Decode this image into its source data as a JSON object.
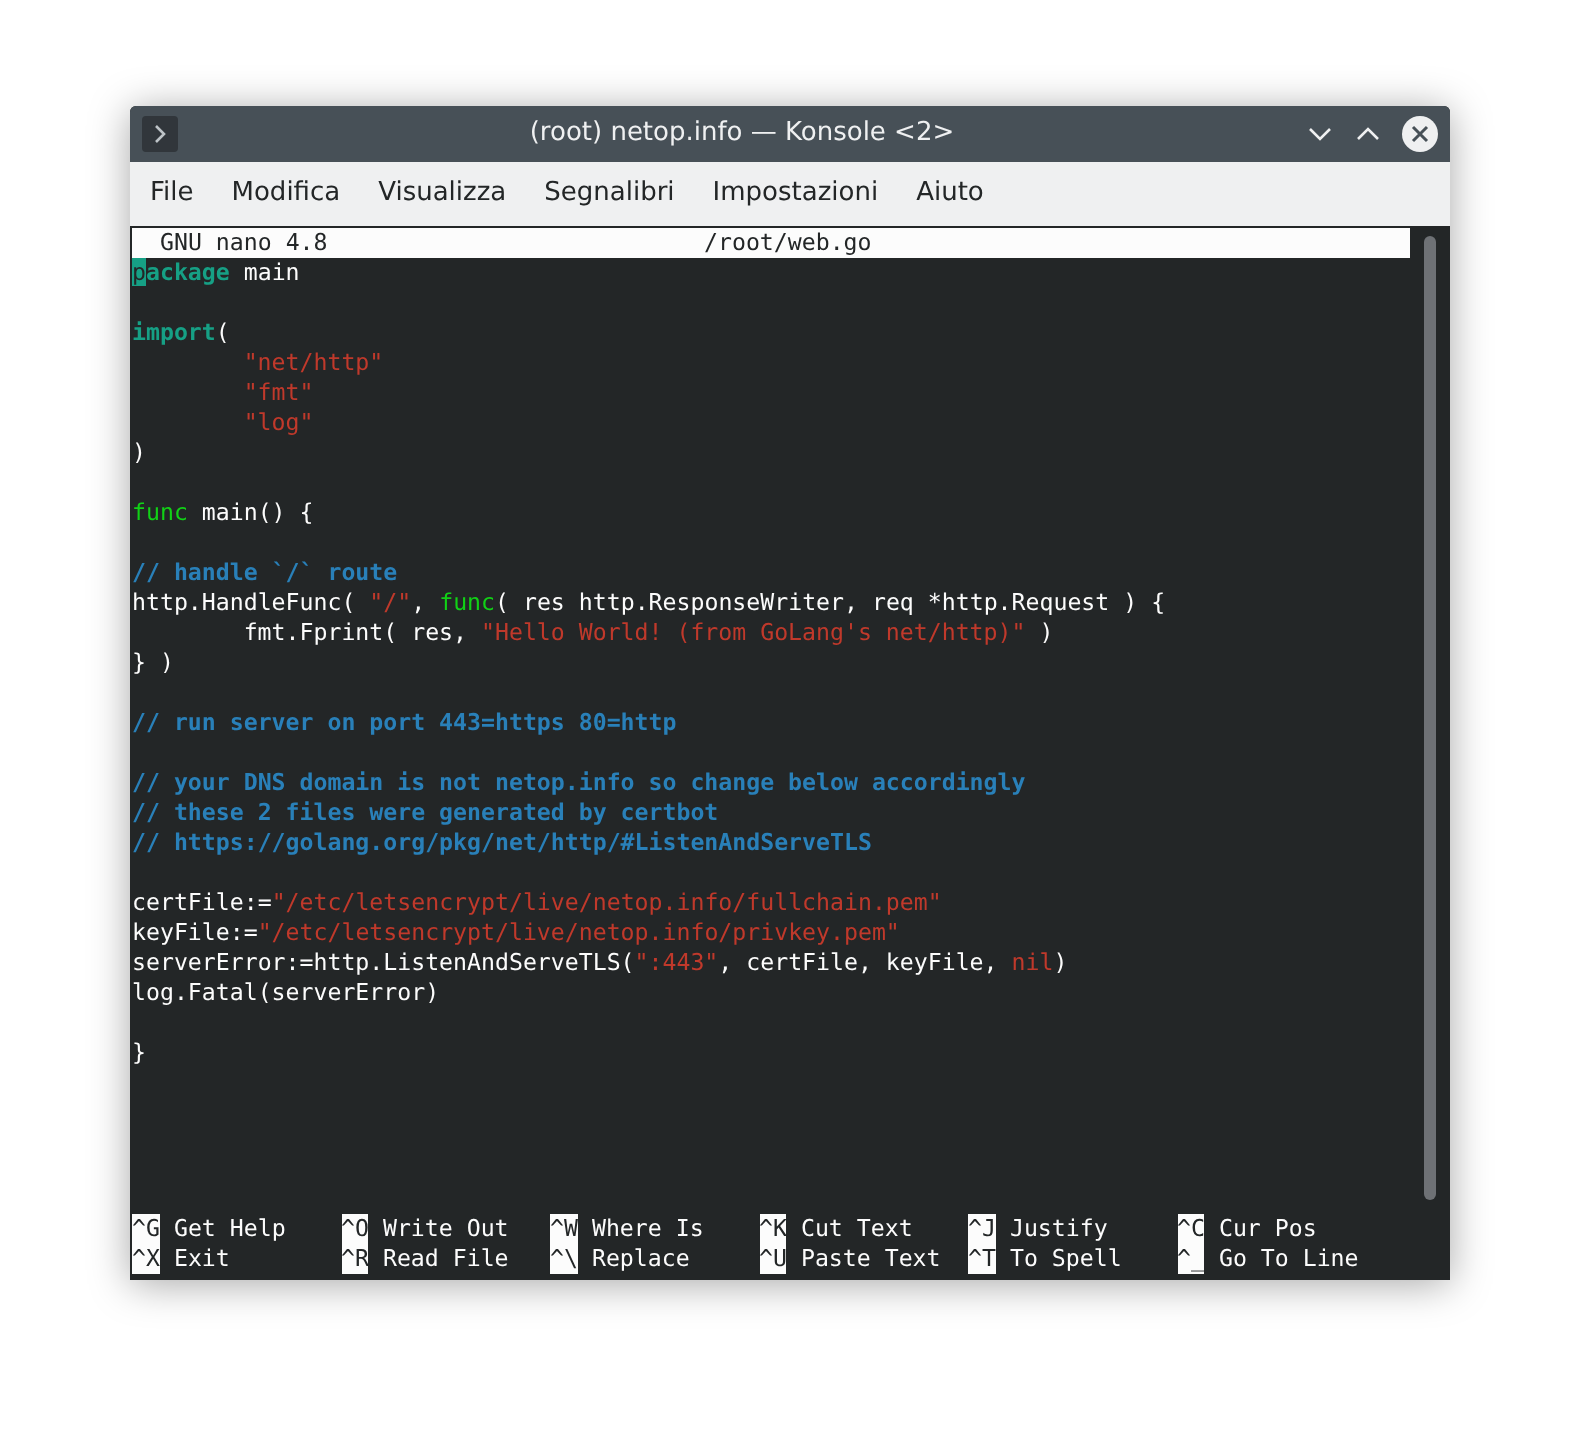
{
  "window": {
    "title": "(root) netop.info — Konsole <2>"
  },
  "menu": [
    "File",
    "Modifica",
    "Visualizza",
    "Segnalibri",
    "Impostazioni",
    "Aiuto"
  ],
  "nano_header": {
    "version": "GNU nano 4.8",
    "filename": "/root/web.go"
  },
  "code_lines": [
    {
      "kind": "code",
      "segments": [
        {
          "text": "p",
          "kind": "cursor"
        },
        {
          "text": "ackage",
          "kind": "keyword"
        },
        {
          "text": " main",
          "kind": "plain"
        }
      ]
    },
    {
      "kind": "blank"
    },
    {
      "kind": "code",
      "segments": [
        {
          "text": "import",
          "kind": "keyword"
        },
        {
          "text": "(",
          "kind": "plain"
        }
      ]
    },
    {
      "kind": "indented",
      "segments": [
        {
          "text": "\"net/http\"",
          "kind": "string"
        }
      ]
    },
    {
      "kind": "indented",
      "segments": [
        {
          "text": "\"fmt\"",
          "kind": "string"
        }
      ]
    },
    {
      "kind": "indented",
      "segments": [
        {
          "text": "\"log\"",
          "kind": "string"
        }
      ]
    },
    {
      "kind": "code",
      "segments": [
        {
          "text": ")",
          "kind": "plain"
        }
      ]
    },
    {
      "kind": "blank"
    },
    {
      "kind": "code",
      "segments": [
        {
          "text": "func",
          "kind": "func"
        },
        {
          "text": " main() {",
          "kind": "plain"
        }
      ]
    },
    {
      "kind": "blank"
    },
    {
      "kind": "code",
      "segments": [
        {
          "text": "// handle `/` route",
          "kind": "comment"
        }
      ]
    },
    {
      "kind": "code",
      "segments": [
        {
          "text": "http.HandleFunc( ",
          "kind": "plain"
        },
        {
          "text": "\"/\"",
          "kind": "string"
        },
        {
          "text": ", ",
          "kind": "plain"
        },
        {
          "text": "func",
          "kind": "func"
        },
        {
          "text": "( res http.ResponseWriter, req *http.Request ) {",
          "kind": "plain"
        }
      ]
    },
    {
      "kind": "indented",
      "segments": [
        {
          "text": "fmt.Fprint( res, ",
          "kind": "plain"
        },
        {
          "text": "\"Hello World! (from GoLang's net/http)\"",
          "kind": "string"
        },
        {
          "text": " )",
          "kind": "plain"
        }
      ]
    },
    {
      "kind": "code",
      "segments": [
        {
          "text": "} )",
          "kind": "plain"
        }
      ]
    },
    {
      "kind": "blank"
    },
    {
      "kind": "code",
      "segments": [
        {
          "text": "// run server on port 443=https 80=http",
          "kind": "comment"
        }
      ]
    },
    {
      "kind": "blank"
    },
    {
      "kind": "code",
      "segments": [
        {
          "text": "// your DNS domain is not netop.info so change below accordingly",
          "kind": "comment"
        }
      ]
    },
    {
      "kind": "code",
      "segments": [
        {
          "text": "// these 2 files were generated by certbot",
          "kind": "comment"
        }
      ]
    },
    {
      "kind": "code",
      "segments": [
        {
          "text": "// https://golang.org/pkg/net/http/#ListenAndServeTLS",
          "kind": "comment"
        }
      ]
    },
    {
      "kind": "blank"
    },
    {
      "kind": "code",
      "segments": [
        {
          "text": "certFile:=",
          "kind": "plain"
        },
        {
          "text": "\"/etc/letsencrypt/live/netop.info/fullchain.pem\"",
          "kind": "string"
        }
      ]
    },
    {
      "kind": "code",
      "segments": [
        {
          "text": "keyFile:=",
          "kind": "plain"
        },
        {
          "text": "\"/etc/letsencrypt/live/netop.info/privkey.pem\"",
          "kind": "string"
        }
      ]
    },
    {
      "kind": "code",
      "segments": [
        {
          "text": "serverError:=http.ListenAndServeTLS(",
          "kind": "plain"
        },
        {
          "text": "\":443\"",
          "kind": "string"
        },
        {
          "text": ", certFile, keyFile, ",
          "kind": "plain"
        },
        {
          "text": "nil",
          "kind": "string"
        },
        {
          "text": ")",
          "kind": "plain"
        }
      ]
    },
    {
      "kind": "code",
      "segments": [
        {
          "text": "log.Fatal(serverError)",
          "kind": "plain"
        }
      ]
    },
    {
      "kind": "blank"
    },
    {
      "kind": "code",
      "segments": [
        {
          "text": "}",
          "kind": "plain"
        }
      ]
    }
  ],
  "shortcuts": [
    [
      {
        "key": "^G",
        "label": "Get Help"
      },
      {
        "key": "^O",
        "label": "Write Out"
      },
      {
        "key": "^W",
        "label": "Where Is"
      },
      {
        "key": "^K",
        "label": "Cut Text"
      },
      {
        "key": "^J",
        "label": "Justify"
      },
      {
        "key": "^C",
        "label": "Cur Pos"
      }
    ],
    [
      {
        "key": "^X",
        "label": "Exit"
      },
      {
        "key": "^R",
        "label": "Read File"
      },
      {
        "key": "^\\",
        "label": "Replace"
      },
      {
        "key": "^U",
        "label": "Paste Text"
      },
      {
        "key": "^T",
        "label": "To Spell"
      },
      {
        "key": "^_",
        "label": "Go To Line"
      }
    ]
  ]
}
